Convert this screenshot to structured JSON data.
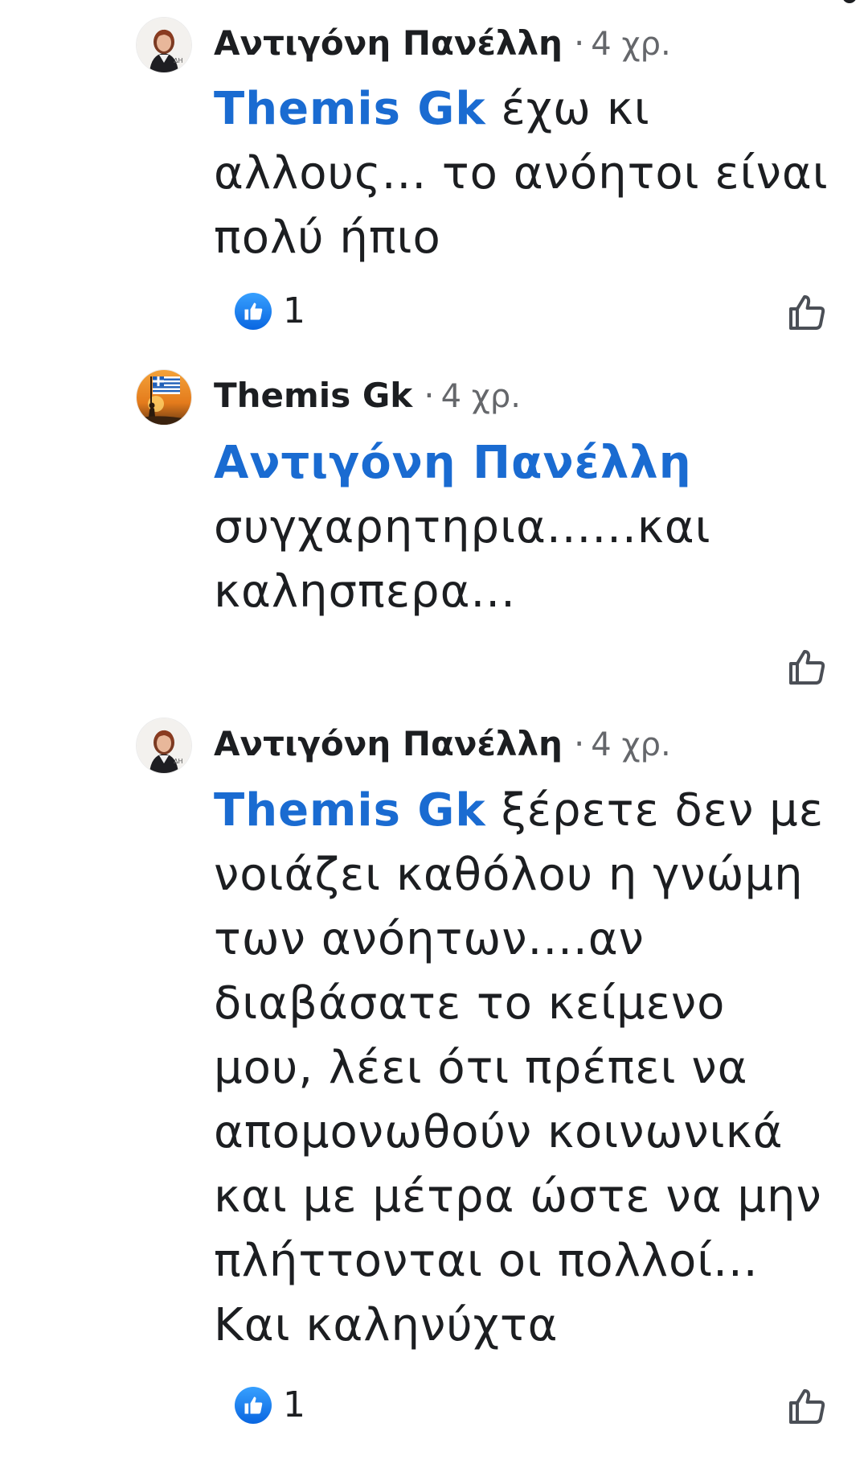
{
  "comments": [
    {
      "author": "Αντιγόνη Πανέλλη",
      "time": "4 χρ.",
      "mention": "Themis Gk",
      "text_lines": [
        " έχω κι",
        "αλλους... το ανόητοι είναι",
        "πολύ ήπιο"
      ],
      "reaction_count": "1"
    },
    {
      "author": "Themis Gk",
      "time": "4 χρ.",
      "mention": "Αντιγόνη Πανέλλη",
      "text_lines": [
        "συγχαρητηρια......και",
        "καλησπερα..."
      ],
      "reaction_count": ""
    },
    {
      "author": "Αντιγόνη Πανέλλη",
      "time": "4 χρ.",
      "mention": "Themis Gk",
      "text_lines": [
        " ξέρετε δεν με",
        "νοιάζει καθόλου η γνώμη",
        "των ανόητων....αν",
        "διαβάσατε το κείμενο",
        "μου, λέει ότι πρέπει να",
        "απομονωθούν κοινωνικά",
        "και με μέτρα ώστε να μην",
        "πλήττονται οι πολλοί...",
        "Και καληνύχτα"
      ],
      "reaction_count": "1"
    }
  ],
  "separator": "·",
  "icons": {
    "reaction": "like-reaction-icon",
    "like_button": "thumbs-up-outline-icon"
  },
  "colors": {
    "mention": "#1a6bd1",
    "meta": "#65676b",
    "like_badge": "#1877f2"
  }
}
